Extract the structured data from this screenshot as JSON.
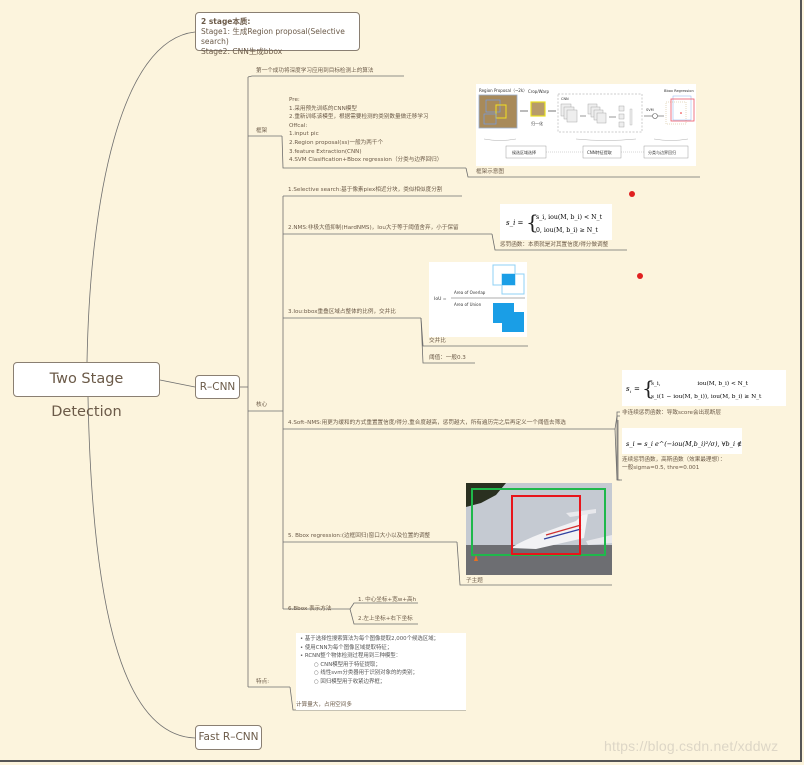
{
  "root": {
    "label": "Two Stage Detection"
  },
  "stage_note": {
    "title": "2 stage本质:",
    "line1": "Stage1: 生成Region proposal(Selective search)",
    "line2": "Stage2: CNN生成bbox"
  },
  "rcnn": {
    "label": "R–CNN",
    "intro": "第一个成功将深度学习应用到目标检测上的算法",
    "framework": {
      "label": "框架",
      "text_lines": [
        "Pre:",
        "1.采用预先训练的CNN模型",
        "2.重新训练该模型，根据需要检测的类别数量做迁移学习",
        "Offcal:",
        "1.input pic",
        "2.Region proposal(ss)一般为两千个",
        "3.feature Extraction(CNN)",
        "4.SVM Clasification+Bbox regression（分类与边界回归）"
      ],
      "diagram_caption": "框架示意图",
      "diagram": {
        "region_proposal": "Region Proposal（~2k）",
        "crop_warp": "Crop/Warp",
        "normalize": "归一化",
        "cnn": "CNN",
        "svm": "SVM",
        "bbox_regression": "Bbox Regression",
        "step1": "候选区域选择",
        "step2": "CNN特征提取",
        "step3": "分类与边界回归"
      }
    },
    "core": {
      "label": "核心",
      "items": [
        {
          "text": "1.Selective search:基于像素piex相近分块，类似相似度分割"
        },
        {
          "text": "2.NMS:非极大值抑制(HardNMS)，Iou大于等于阈值舍弃，小于保留",
          "formula_lhs": "s_i =",
          "formula_case1": "s_i,   iou(M, b_i) < N_t",
          "formula_case2": "0,    iou(M, b_i) ≥ N_t",
          "caption": "惩罚函数：本质就是对其置信度/得分做调整"
        },
        {
          "text": "3.Iou:bbox重叠区域占整体的比例，交并比",
          "iou_label": "IoU =",
          "iou_numerator": "Area of Overlap",
          "iou_denominator": "Area of Union",
          "sub1": "交并比",
          "sub2": "阈值：一般0.3"
        },
        {
          "text": "4.Soft–NMS:用更为缓和的方式重置置信度/得分,重合度越高，惩罚越大，所有遍历完之后再定义一个阈值去筛选",
          "formula1_case1": "s_i,                    iou(M, b_i) < N_t",
          "formula1_case2": "s_i(1 − iou(M, b_i)),   iou(M, b_i) ≥ N_t",
          "caption1": "非连续惩罚函数：导致score会出现断层",
          "formula2": "s_i = s_i e^(−iou(M,b_i)²/σ), ∀b_i ∉ D",
          "caption2_line1": "连续惩罚函数，高斯函数（效果最理想）：",
          "caption2_line2": "一般sigma=0.5, thre=0.001"
        },
        {
          "text": "5. Bbox regression:(边框回归)窗口大小以及位置的调整",
          "caption": "子主题"
        },
        {
          "text": "6.Bbox 表示方法",
          "sub1": "1. 中心坐标+宽w+高h",
          "sub2": "2.左上坐标+右下坐标"
        }
      ]
    },
    "features": {
      "label": "特点:",
      "bullets": [
        {
          "level": 1,
          "text": "基于选择性搜索算法为每个图像提取2,000个候选区域；"
        },
        {
          "level": 1,
          "text": "使用CNN为每个图像区域提取特征；"
        },
        {
          "level": 1,
          "text": "RCNN整个物体检测过程用到三种模型："
        },
        {
          "level": 2,
          "text": "CNN模型用于特征提取；"
        },
        {
          "level": 2,
          "text": "线性svm分类器用于识别对象的的类别；"
        },
        {
          "level": 2,
          "text": "回归模型用于收紧边界框；"
        }
      ],
      "note": "计算量大，占用空间多"
    }
  },
  "fast_rcnn": {
    "label": "Fast R–CNN"
  },
  "watermark": "https://blog.csdn.net/xddwz",
  "colors": {
    "background": "#fcf4dd",
    "line": "#6e6e6e",
    "text": "#6b5a48",
    "marker": "#e02020",
    "iou_blue": "#1a9ee6",
    "bbox_green": "#1fb84b",
    "bbox_red": "#e8151b"
  }
}
